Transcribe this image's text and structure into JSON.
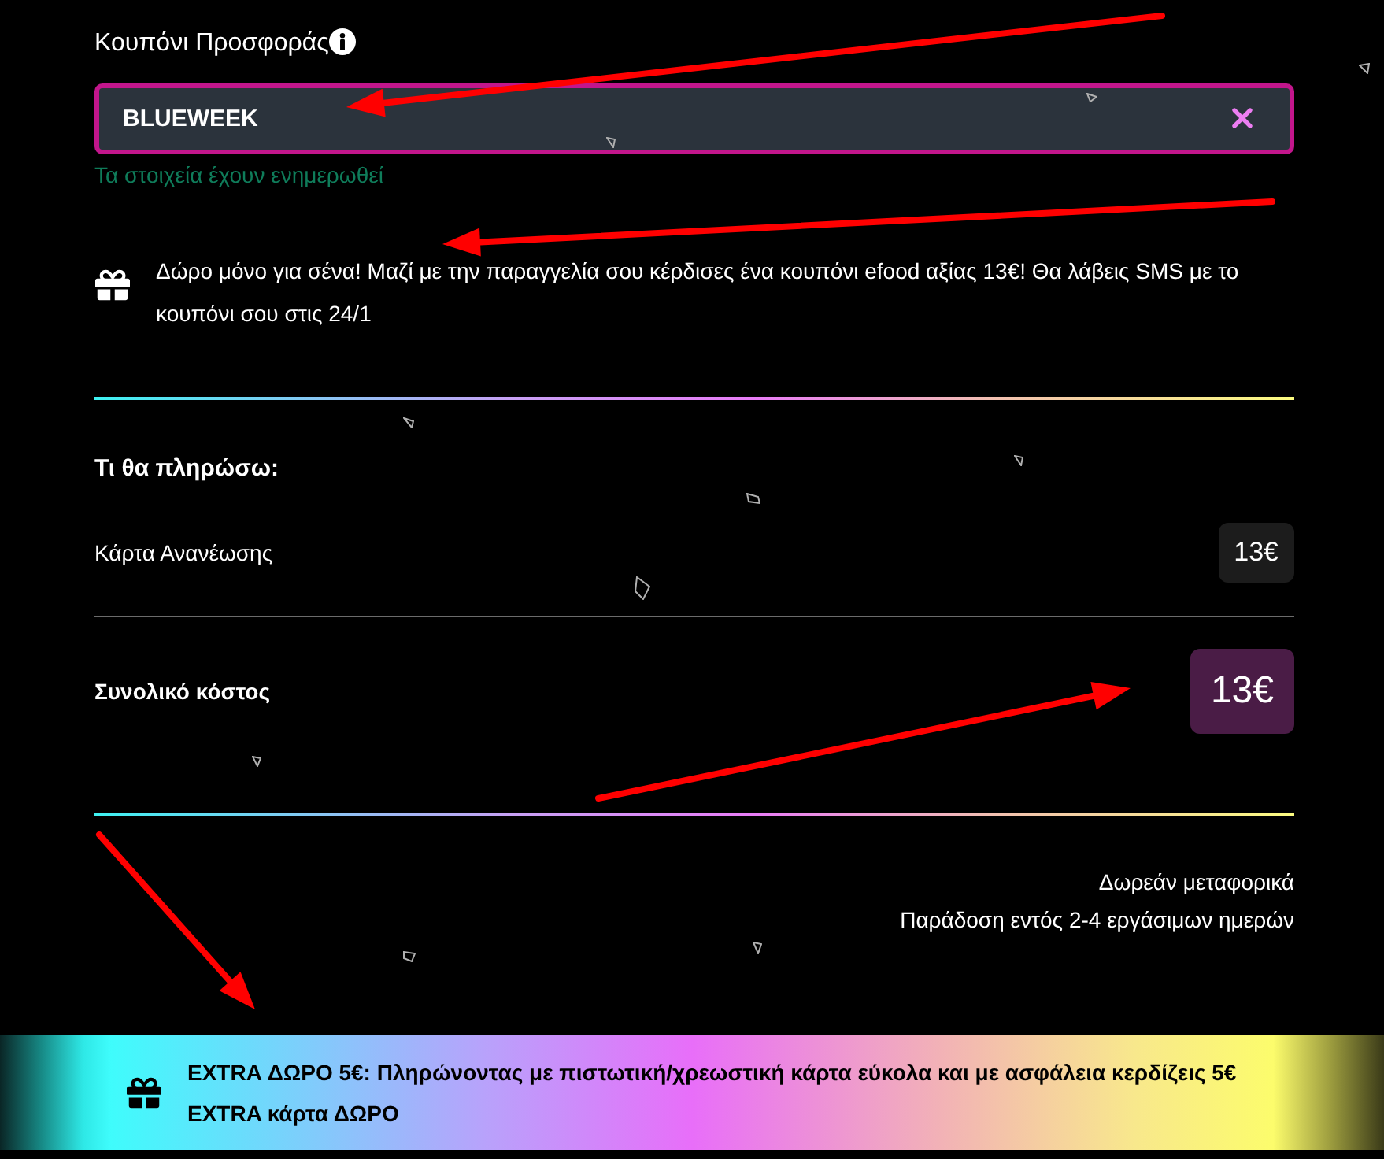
{
  "coupon": {
    "label": "Κουπόνι Προσφοράς",
    "value": "BLUEWEEK",
    "status": "Τα στοιχεία έχουν ενημερωθεί"
  },
  "gift_notice": {
    "text": "Δώρο μόνο για σένα! Μαζί με την παραγγελία σου κέρδισες ένα κουπόνι efood αξίας 13€! Θα λάβεις SMS με το κουπόνι σου στις 24/1"
  },
  "summary": {
    "heading": "Τι θα πληρώσω:",
    "items": [
      {
        "label": "Κάρτα Ανανέωσης",
        "price": "13€"
      }
    ],
    "total": {
      "label": "Συνολικό κόστος",
      "price": "13€"
    }
  },
  "delivery": [
    "Δωρεάν μεταφορικά",
    "Παράδοση εντός 2-4 εργάσιμων ημερών"
  ],
  "banner": {
    "text": "EXTRA ΔΩΡΟ 5€: Πληρώνοντας με πιστωτική/χρεωστική κάρτα εύκολα και με ασφάλεια κερδίζεις 5€ EXTRA κάρτα ΔΩΡΟ"
  }
}
